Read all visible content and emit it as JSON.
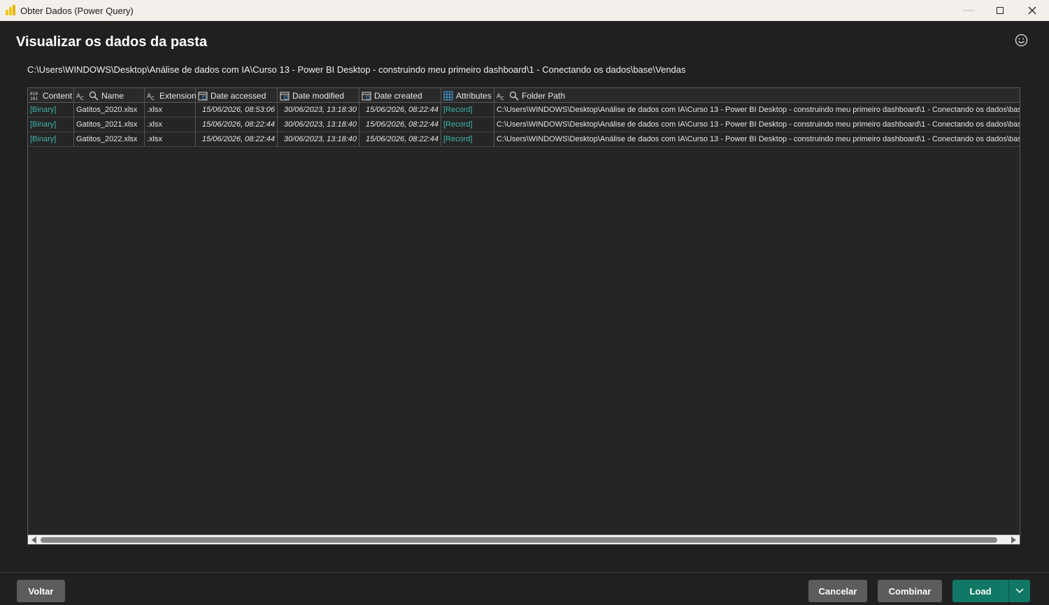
{
  "window": {
    "title": "Obter Dados (Power Query)"
  },
  "page": {
    "heading": "Visualizar os dados da pasta",
    "path": "C:\\Users\\WINDOWS\\Desktop\\Análise de dados com IA\\Curso 13 - Power BI Desktop - construindo meu primeiro dashboard\\1 - Conectando os dados\\base\\Vendas"
  },
  "table": {
    "columns": [
      {
        "label": "Content",
        "type_icon": "binary-type-icon"
      },
      {
        "label": "Name",
        "type_icon": "text-type-icon"
      },
      {
        "label": "Extension",
        "type_icon": "text-type-icon"
      },
      {
        "label": "Date accessed",
        "type_icon": "datetime-type-icon"
      },
      {
        "label": "Date modified",
        "type_icon": "datetime-type-icon"
      },
      {
        "label": "Date created",
        "type_icon": "datetime-type-icon"
      },
      {
        "label": "Attributes",
        "type_icon": "table-type-icon"
      },
      {
        "label": "Folder Path",
        "type_icon": "text-type-icon"
      }
    ],
    "rows": [
      {
        "content": "[Binary]",
        "name": "Gatitos_2020.xlsx",
        "extension": ".xlsx",
        "date_accessed": "15/06/2026, 08:53:06",
        "date_modified": "30/06/2023, 13:18:30",
        "date_created": "15/06/2026, 08:22:44",
        "attributes": "[Record]",
        "folder_path": "C:\\Users\\WINDOWS\\Desktop\\Análise de dados com IA\\Curso 13 - Power BI Desktop - construindo meu primeiro dashboard\\1 - Conectando os dados\\bas"
      },
      {
        "content": "[Binary]",
        "name": "Gatitos_2021.xlsx",
        "extension": ".xlsx",
        "date_accessed": "15/06/2026, 08:22:44",
        "date_modified": "30/06/2023, 13:18:40",
        "date_created": "15/06/2026, 08:22:44",
        "attributes": "[Record]",
        "folder_path": "C:\\Users\\WINDOWS\\Desktop\\Análise de dados com IA\\Curso 13 - Power BI Desktop - construindo meu primeiro dashboard\\1 - Conectando os dados\\bas"
      },
      {
        "content": "[Binary]",
        "name": "Gatitos_2022.xlsx",
        "extension": ".xlsx",
        "date_accessed": "15/06/2026, 08:22:44",
        "date_modified": "30/06/2023, 13:18:40",
        "date_created": "15/06/2026, 08:22:44",
        "attributes": "[Record]",
        "folder_path": "C:\\Users\\WINDOWS\\Desktop\\Análise de dados com IA\\Curso 13 - Power BI Desktop - construindo meu primeiro dashboard\\1 - Conectando os dados\\bas"
      }
    ]
  },
  "footer": {
    "back_label": "Voltar",
    "cancel_label": "Cancelar",
    "combine_label": "Combinar",
    "load_label": "Load"
  },
  "colors": {
    "accent": "#117865",
    "link": "#3fb5a8",
    "background": "#202020"
  }
}
